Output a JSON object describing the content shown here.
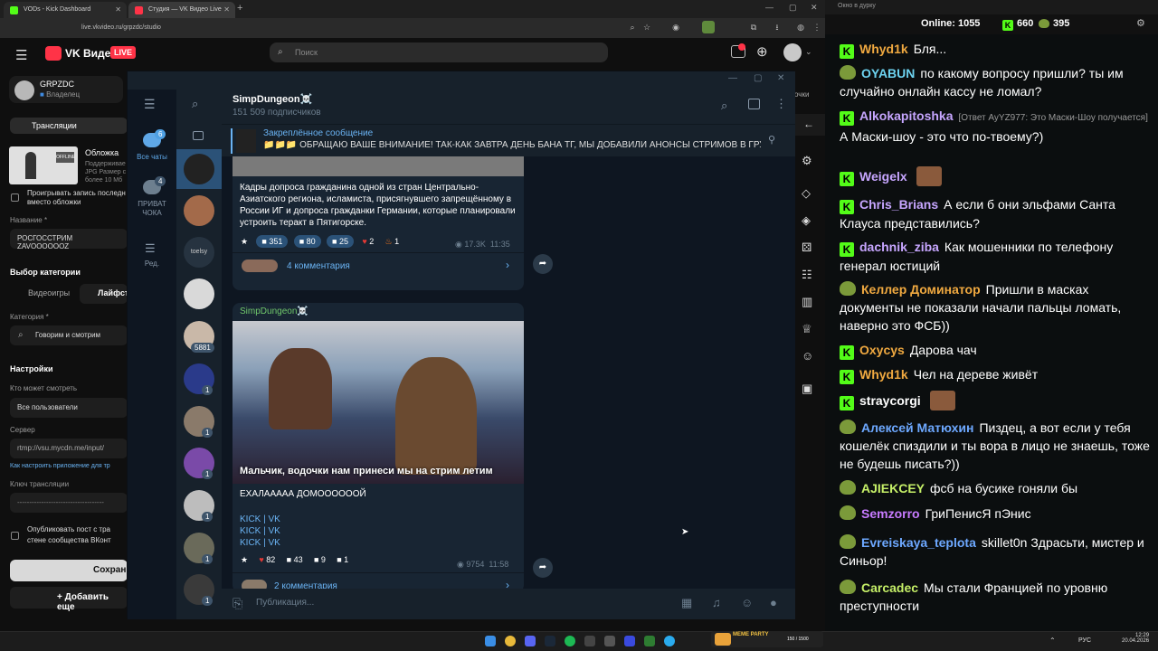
{
  "browser": {
    "tabs": [
      {
        "title": "VODs - Kick Dashboard",
        "color": "#53fc18"
      },
      {
        "title": "Студия — VK Видео Live",
        "color": "#ff3347"
      }
    ],
    "url": "live.vkvideo.ru/grpzdc/studio"
  },
  "vk": {
    "logo_text": "VK Видео",
    "live_badge": "LIVE",
    "search_placeholder": "Поиск",
    "user_name": "GRPZDC",
    "user_role": "Владелец",
    "tab_streams": "Трансляции",
    "cover_label": "Обложка",
    "cover_hint": [
      "Поддерживае",
      "JPG Размер с",
      "более 10 Мб"
    ],
    "cover_thumb_label": "OFFLINE",
    "checkbox_record": "Проигрывать запись последн",
    "checkbox_record_2": "вместо обложки",
    "title_label": "Название *",
    "title_value": "РОСГОССТРИМ ZAVOOOOOOZ",
    "category_choice_label": "Выбор категории",
    "cat_games": "Видеоигры",
    "cat_life": "Лайфст",
    "category_label": "Категория *",
    "category_value": "Говорим и смотрим",
    "settings_label": "Настройки",
    "who_can_watch": "Кто может смотреть",
    "who_value": "Все пользователи",
    "server_label": "Сервер",
    "server_value": "rtmp://vsu.mycdn.me/input/",
    "how_to_link": "Как настроить приложение для тр",
    "key_label": "Ключ трансляции",
    "key_value": "------------------------------------",
    "publish_label": "Опубликовать пост с тра",
    "publish_label_2": "стене сообщества ВКонт",
    "save_button": "Сохрани",
    "add_button": "+ Добавить еще",
    "right_cut_text": "очки"
  },
  "telegram": {
    "folders": [
      {
        "label": "Все чаты",
        "count": "6"
      },
      {
        "label": "ПРИВАТ ЧОКА",
        "count": "4"
      },
      {
        "label": "Ред.",
        "count": ""
      }
    ],
    "chat_badges": [
      "5881",
      "1",
      "1",
      "1",
      "1",
      "1",
      "1"
    ],
    "chat_avatar_text": "toelsy",
    "channel_name": "SimpDungeon☠️",
    "subscribers": "151 509 подписчиков",
    "pinned_title": "Закреплённое сообщение",
    "pinned_text": "📁📁📁 ОБРАЩАЮ ВАШЕ ВНИМАНИЕ! ТАК-КАК ЗАВТРА ДЕНЬ БАНА ТГ, МЫ ДОБАВИЛИ АНОНСЫ СТРИМОВ В ГРУП...",
    "post1": {
      "text": "Кадры допроса гражданина одной из стран Центрально-Азиатского региона, исламиста, присягнувшего запрещённому в России ИГ и допроса гражданки Германии, которые планировали устроить теракт в Пятигорске.",
      "reactions": [
        "351",
        "80",
        "25",
        "2",
        "1"
      ],
      "views": "17.3K",
      "time": "11:35",
      "comments": "4 комментария"
    },
    "post2": {
      "author": "SimpDungeon☠️",
      "caption": "Мальчик, водочки нам принеси  мы на стрим летим",
      "text": "ЕХАЛААААА ДОМООООООЙ",
      "links": [
        "KICK | VK",
        "KICK | VK",
        "KICK | VK"
      ],
      "reactions": [
        "82",
        "43",
        "9",
        "1"
      ],
      "views": "9754",
      "time": "11:58",
      "comments": "2 комментария"
    },
    "input_placeholder": "Публикация..."
  },
  "chat": {
    "window_title": "Окно в дурку",
    "online_label": "Online:",
    "online_value": "1055",
    "kick_count": "660",
    "vk_count": "395",
    "messages": [
      {
        "badge": "kick",
        "name": "Whyd1k",
        "color": "#f0a940",
        "text": "Бля..."
      },
      {
        "badge": "vk",
        "name": "OYABUN",
        "color": "#6dd3f0",
        "text": "по какому вопросу пришли? ты им случайно онлайн кассу не ломал?"
      },
      {
        "badge": "kick",
        "name": "Alkokapitoshka",
        "color": "#c7a6ff",
        "reply": "[Ответ AyYZ977: Это Маски-Шоу получается]",
        "text": "А Маски-шоу - это что по-твоему?)"
      },
      {
        "badge": "kick",
        "name": "Weigelx",
        "color": "#c7a6ff",
        "text": ""
      },
      {
        "badge": "kick",
        "name": "Chris_Brians",
        "color": "#c7a6ff",
        "text": "А если б они эльфами Санта Клауса представились?"
      },
      {
        "badge": "kick",
        "name": "dachnik_ziba",
        "color": "#c7a6ff",
        "text": "Как мошенники по телефону генерал юстиций"
      },
      {
        "badge": "vk",
        "name": "Келлер Доминатор",
        "color": "#f0a940",
        "text": "Пришли в масках документы не показали начали пальцы ломать, наверно это ФСБ))"
      },
      {
        "badge": "kick",
        "name": "Oxycys",
        "color": "#f0a940",
        "text": "Дарова чач"
      },
      {
        "badge": "kick",
        "name": "Whyd1k",
        "color": "#f0a940",
        "text": "Чел на дереве живёт"
      },
      {
        "badge": "kick",
        "name": "straycorgi",
        "color": "#ffffff",
        "text": ""
      },
      {
        "badge": "vk",
        "name": "Алексей Матюхин",
        "color": "#6da8ff",
        "text": "Пиздец, а вот если у тебя кошелёк спиздили и ты вора в лицо не знаешь, тоже не будешь писать?))"
      },
      {
        "badge": "vk",
        "name": "AJIEKCEY",
        "color": "#c6f068",
        "text": "фсб на бусике гоняли бы"
      },
      {
        "badge": "vk",
        "name": "Semzorro",
        "color": "#c77bff",
        "text": "ГриПенисЯ  пЭнис"
      },
      {
        "badge": "vk",
        "name": "Evreiskaya_teplota",
        "color": "#6da8ff",
        "text": "skillet0n Здрасьти, мистер и Синьор!"
      },
      {
        "badge": "vk",
        "name": "Carcadec",
        "color": "#c6f068",
        "text": "Мы стали Францией по уровню преступности"
      }
    ]
  },
  "taskbar": {
    "lang": "РУС",
    "time": "12:29",
    "date": "20.04.2026",
    "meme_label": "MEME PARTY",
    "meme_counter": "150 / 1500"
  }
}
